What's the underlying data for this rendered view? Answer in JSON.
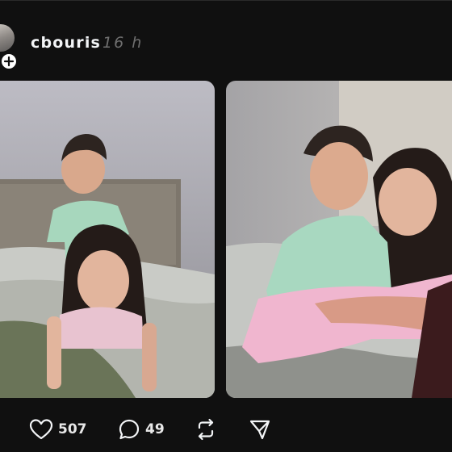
{
  "post": {
    "username": "cbouris",
    "timestamp": "16 h",
    "images": [
      {
        "alt": "Two children sitting on a bed"
      },
      {
        "alt": "Two children hugging on a bed"
      }
    ]
  },
  "actions": {
    "likes": "507",
    "comments": "49"
  },
  "icons": {
    "follow": "plus-icon",
    "like": "heart-icon",
    "comment": "comment-icon",
    "repost": "repost-icon",
    "share": "send-icon"
  },
  "colors": {
    "background": "#101010",
    "text": "#f3f5f7",
    "muted": "#6f6f6f"
  }
}
